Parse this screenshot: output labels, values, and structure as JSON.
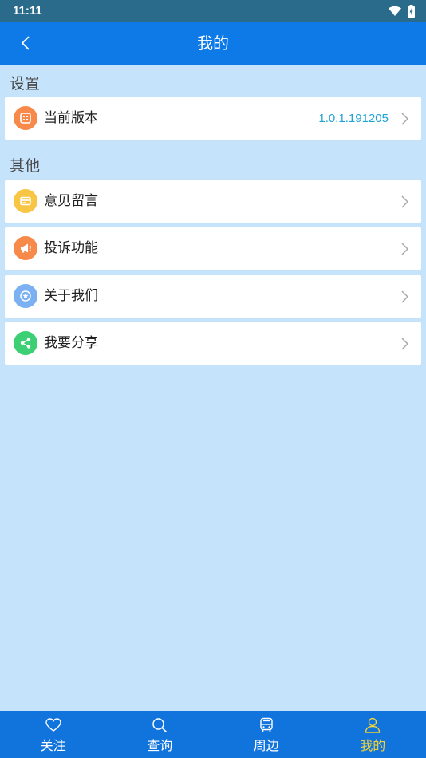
{
  "status_bar": {
    "time": "11:11"
  },
  "header": {
    "title": "我的"
  },
  "sections": [
    {
      "title": "设置",
      "items": [
        {
          "label": "当前版本",
          "value": "1.0.1.191205",
          "icon": "app-grid-icon",
          "icon_color": "#f7894a"
        }
      ]
    },
    {
      "title": "其他",
      "items": [
        {
          "label": "意见留言",
          "value": "",
          "icon": "card-icon",
          "icon_color": "#f8c544"
        },
        {
          "label": "投诉功能",
          "value": "",
          "icon": "megaphone-icon",
          "icon_color": "#f7894a"
        },
        {
          "label": "关于我们",
          "value": "",
          "icon": "star-badge-icon",
          "icon_color": "#7bb0f2"
        },
        {
          "label": "我要分享",
          "value": "",
          "icon": "share-icon",
          "icon_color": "#3ccf73"
        }
      ]
    }
  ],
  "bottom_nav": {
    "items": [
      {
        "label": "关注",
        "icon": "heart-icon",
        "active": false
      },
      {
        "label": "查询",
        "icon": "search-icon",
        "active": false
      },
      {
        "label": "周边",
        "icon": "bus-icon",
        "active": false
      },
      {
        "label": "我的",
        "icon": "person-icon",
        "active": true
      }
    ],
    "active_color": "#f0d23a"
  },
  "colors": {
    "header_bg": "#0e7ae8",
    "status_bar_bg": "#2a6b8c",
    "page_bg": "#c6e3fc",
    "value_text": "#1fa3d6"
  }
}
